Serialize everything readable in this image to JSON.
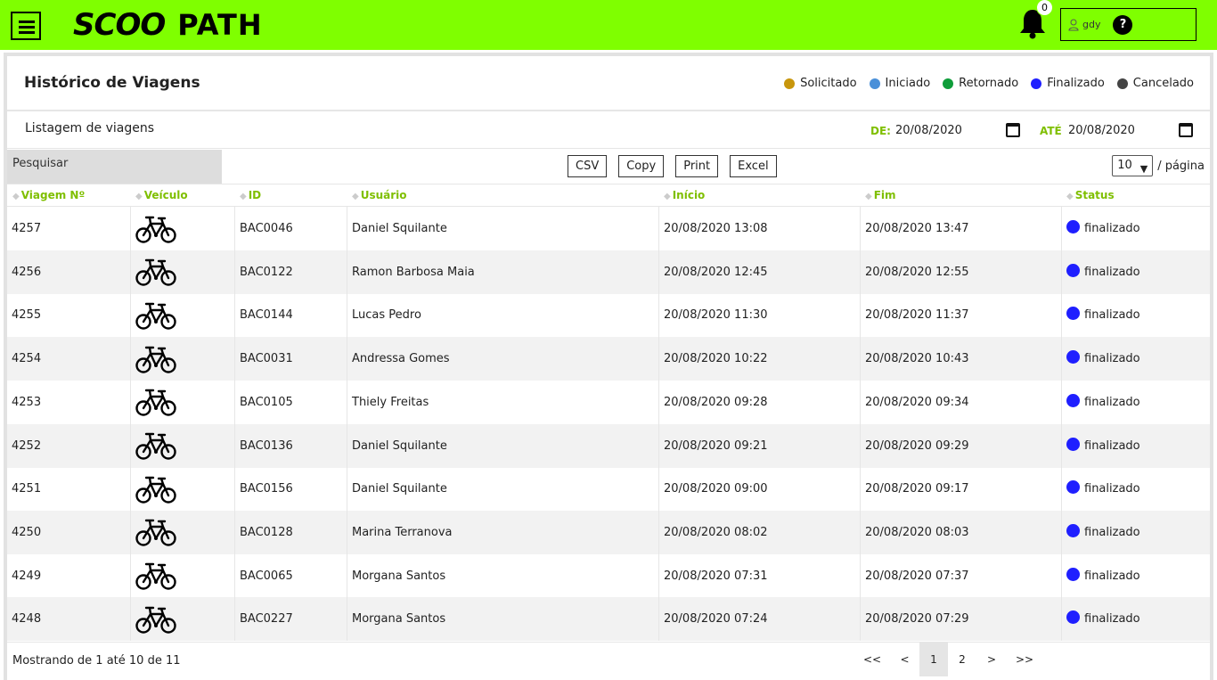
{
  "brand": {
    "scoo": "SCOO",
    "path": "PATH"
  },
  "notifications": {
    "count": "0"
  },
  "user": {
    "name": "gdy",
    "help": "?"
  },
  "page": {
    "title": "Histórico de Viagens",
    "subtitle": "Listagem de viagens"
  },
  "legend": [
    {
      "label": "Solicitado",
      "color": "#c8960c"
    },
    {
      "label": "Iniciado",
      "color": "#4a90d9"
    },
    {
      "label": "Retornado",
      "color": "#0f9d3a"
    },
    {
      "label": "Finalizado",
      "color": "#1f1fff"
    },
    {
      "label": "Cancelado",
      "color": "#444444"
    }
  ],
  "filters": {
    "from_label": "DE:",
    "from_value": "20/08/2020",
    "to_label": "ATÉ",
    "to_value": "20/08/2020"
  },
  "search": {
    "label": "Pesquisar"
  },
  "export_buttons": [
    "CSV",
    "Copy",
    "Print",
    "Excel"
  ],
  "per_page": {
    "value": "10",
    "suffix": "/ página"
  },
  "table": {
    "columns": [
      "Viagem Nº",
      "Veículo",
      "ID",
      "Usuário",
      "Início",
      "Fim",
      "Status"
    ],
    "vehicle_icon": "bicycle-icon",
    "rows": [
      {
        "trip": "4257",
        "id": "BAC0046",
        "user": "Daniel Squilante",
        "start": "20/08/2020 13:08",
        "end": "20/08/2020 13:47",
        "status": "finalizado"
      },
      {
        "trip": "4256",
        "id": "BAC0122",
        "user": "Ramon Barbosa Maia",
        "start": "20/08/2020 12:45",
        "end": "20/08/2020 12:55",
        "status": "finalizado"
      },
      {
        "trip": "4255",
        "id": "BAC0144",
        "user": "Lucas Pedro",
        "start": "20/08/2020 11:30",
        "end": "20/08/2020 11:37",
        "status": "finalizado"
      },
      {
        "trip": "4254",
        "id": "BAC0031",
        "user": "Andressa Gomes",
        "start": "20/08/2020 10:22",
        "end": "20/08/2020 10:43",
        "status": "finalizado"
      },
      {
        "trip": "4253",
        "id": "BAC0105",
        "user": "Thiely Freitas",
        "start": "20/08/2020 09:28",
        "end": "20/08/2020 09:34",
        "status": "finalizado"
      },
      {
        "trip": "4252",
        "id": "BAC0136",
        "user": "Daniel Squilante",
        "start": "20/08/2020 09:21",
        "end": "20/08/2020 09:29",
        "status": "finalizado"
      },
      {
        "trip": "4251",
        "id": "BAC0156",
        "user": "Daniel Squilante",
        "start": "20/08/2020 09:00",
        "end": "20/08/2020 09:17",
        "status": "finalizado"
      },
      {
        "trip": "4250",
        "id": "BAC0128",
        "user": "Marina Terranova",
        "start": "20/08/2020 08:02",
        "end": "20/08/2020 08:03",
        "status": "finalizado"
      },
      {
        "trip": "4249",
        "id": "BAC0065",
        "user": "Morgana Santos",
        "start": "20/08/2020 07:31",
        "end": "20/08/2020 07:37",
        "status": "finalizado"
      },
      {
        "trip": "4248",
        "id": "BAC0227",
        "user": "Morgana Santos",
        "start": "20/08/2020 07:24",
        "end": "20/08/2020 07:29",
        "status": "finalizado"
      }
    ]
  },
  "footer": {
    "summary": "Mostrando de 1 até 10 de 11"
  },
  "pagination": {
    "items": [
      "<<",
      "<",
      "1",
      "2",
      ">",
      ">>"
    ],
    "active": "1"
  }
}
